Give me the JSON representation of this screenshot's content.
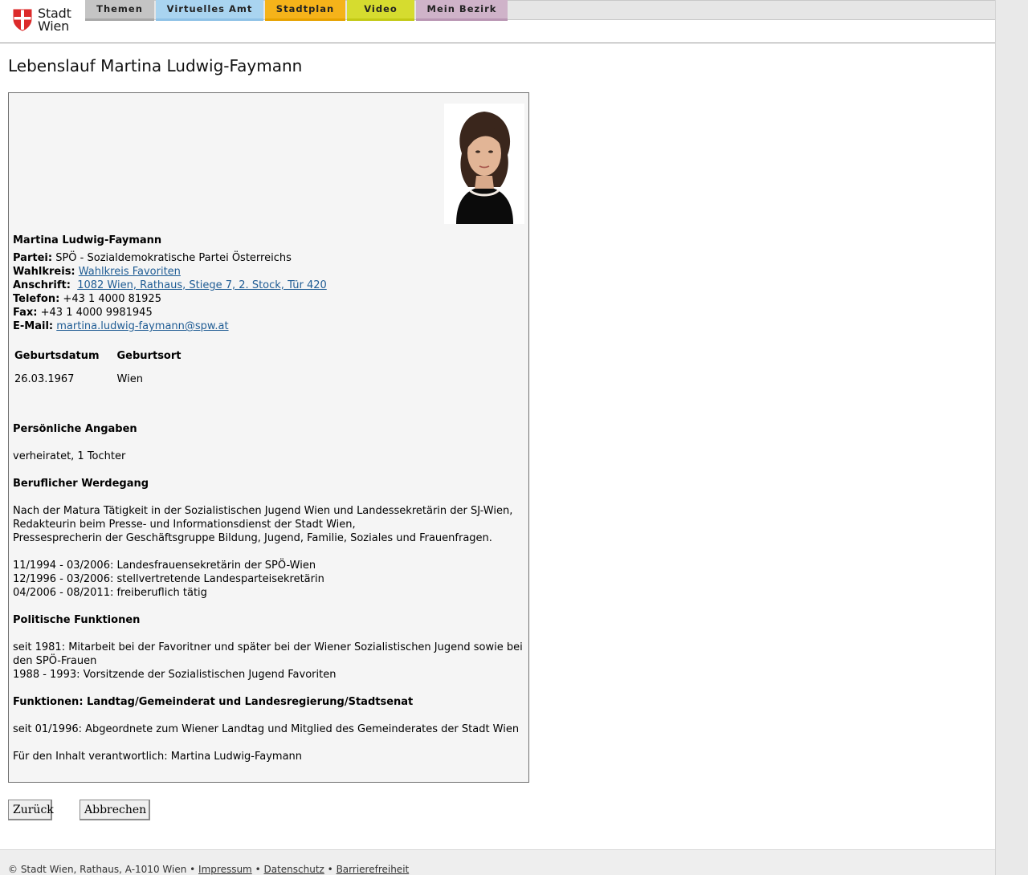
{
  "header": {
    "logo_line1": "Stadt",
    "logo_line2": "Wien",
    "tabs": [
      {
        "label": "Themen",
        "color": "#c4c4c4"
      },
      {
        "label": "Virtuelles Amt",
        "color": "#a9d4f0"
      },
      {
        "label": "Stadtplan",
        "color": "#f5b31a"
      },
      {
        "label": "Video",
        "color": "#d6dc2f"
      },
      {
        "label": "Mein Bezirk",
        "color": "#cfb3c9"
      }
    ]
  },
  "page": {
    "title": "Lebenslauf Martina Ludwig-Faymann"
  },
  "profile": {
    "name": "Martina Ludwig-Faymann",
    "party_label": "Partei:",
    "party_value": "SPÖ - Sozialdemokratische Partei Österreichs",
    "district_label": "Wahlkreis:",
    "district_value": "Wahlkreis Favoriten",
    "address_label": "Anschrift:",
    "address_value": "1082 Wien, Rathaus, Stiege 7, 2. Stock, Tür 420",
    "phone_label": "Telefon:",
    "phone_value": "+43 1 4000 81925",
    "fax_label": "Fax:",
    "fax_value": "+43 1 4000 9981945",
    "email_label": "E-Mail:",
    "email_value": "martina.ludwig-faymann@spw.at",
    "birth_table": {
      "headers": [
        "Geburtsdatum",
        "Geburtsort"
      ],
      "row": [
        "26.03.1967",
        "Wien"
      ]
    },
    "sections": {
      "personal_title": "Persönliche Angaben",
      "personal_text": "verheiratet, 1 Tochter",
      "career_title": "Beruflicher Werdegang",
      "career_lines": [
        "Nach der Matura Tätigkeit in der Sozialistischen Jugend Wien und Landessekretärin der SJ-Wien,",
        "Redakteurin beim Presse- und Informationsdienst der Stadt Wien,",
        "Pressesprecherin der Geschäftsgruppe Bildung, Jugend, Familie, Soziales und Frauenfragen."
      ],
      "career_dates": [
        "11/1994 - 03/2006: Landesfrauensekretärin der SPÖ-Wien",
        "12/1996 - 03/2006: stellvertretende Landesparteisekretärin",
        "04/2006 - 08/2011: freiberuflich tätig"
      ],
      "political_title": "Politische Funktionen",
      "political_lines": [
        "seit 1981: Mitarbeit bei der Favoritner und später bei der Wiener Sozialistischen Jugend sowie bei den SPÖ-Frauen",
        "1988 - 1993: Vorsitzende der Sozialistischen Jugend Favoriten"
      ],
      "functions_title": "Funktionen: Landtag/Gemeinderat und Landesregierung/Stadtsenat",
      "functions_text": "seit 01/1996: Abgeordnete zum Wiener Landtag und Mitglied des Gemeinderates der Stadt Wien",
      "responsible_text": "Für den Inhalt verantwortlich: Martina Ludwig-Faymann"
    }
  },
  "buttons": {
    "back": "Zurück",
    "cancel": "Abbrechen"
  },
  "footer": {
    "copyright": "© Stadt Wien, Rathaus, A-1010 Wien",
    "separator": "•",
    "imprint": "Impressum",
    "privacy": "Datenschutz",
    "accessibility": "Barrierefreiheit"
  }
}
